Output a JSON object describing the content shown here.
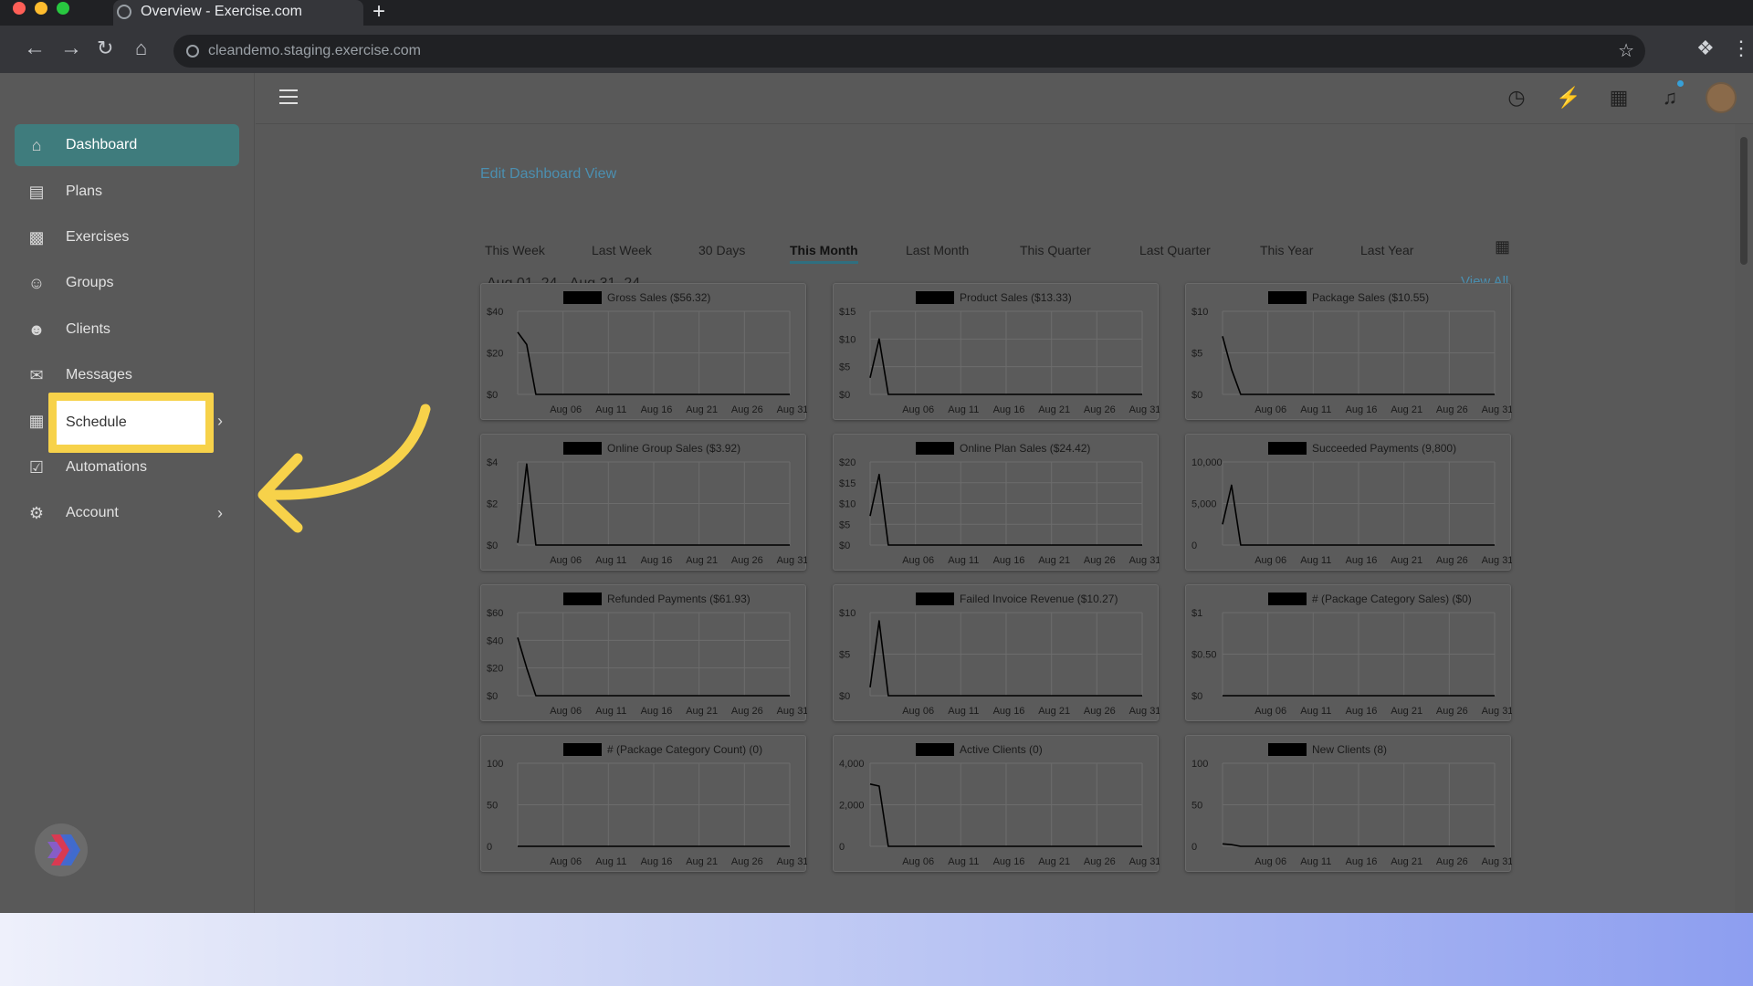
{
  "browser": {
    "tab_title": "Overview - Exercise.com",
    "new_tab": "+",
    "url": "cleandemo.staging.exercise.com"
  },
  "sidebar": {
    "items": [
      {
        "label": "Dashboard",
        "icon": "home-icon"
      },
      {
        "label": "Plans",
        "icon": "clipboard-icon"
      },
      {
        "label": "Exercises",
        "icon": "dumbbell-icon"
      },
      {
        "label": "Groups",
        "icon": "users-icon"
      },
      {
        "label": "Clients",
        "icon": "user-icon"
      },
      {
        "label": "Messages",
        "icon": "envelope-icon"
      },
      {
        "label": "Schedule",
        "icon": "calendar-icon"
      },
      {
        "label": "Automations",
        "icon": "checkbox-icon"
      },
      {
        "label": "Account",
        "icon": "gear-icon"
      }
    ]
  },
  "dashboard": {
    "edit_link": "Edit Dashboard View",
    "filters": [
      "This Week",
      "Last Week",
      "30 Days",
      "This Month",
      "Last Month",
      "This Quarter",
      "Last Quarter",
      "This Year",
      "Last Year"
    ],
    "active_filter": "This Month",
    "date_range": "Aug 01, 24 - Aug 31, 24",
    "view_all": "View All"
  },
  "colors": {
    "accent": "#3f7c7d",
    "link": "#4b8fb0",
    "highlight": "#f7d24a",
    "arrow": "#f7d24a"
  },
  "chart_data": [
    {
      "type": "line",
      "title": "Gross Sales ($56.32)",
      "x": [
        "Aug 01",
        "Aug 02",
        "Aug 03",
        "Aug 04",
        "Aug 05",
        "Aug 06",
        "Aug 11",
        "Aug 16",
        "Aug 21",
        "Aug 26",
        "Aug 31"
      ],
      "xticks": [
        "Aug 06",
        "Aug 11",
        "Aug 16",
        "Aug 21",
        "Aug 26",
        "Aug 31"
      ],
      "yticks": [
        "$0",
        "$20",
        "$40"
      ],
      "ylim": [
        0,
        40
      ],
      "values": [
        30,
        24,
        0,
        0,
        0,
        0,
        0,
        0,
        0,
        0,
        0
      ]
    },
    {
      "type": "line",
      "title": "Product Sales ($13.33)",
      "x": [
        "Aug 01",
        "Aug 02",
        "Aug 03",
        "Aug 04",
        "Aug 05",
        "Aug 06",
        "Aug 11",
        "Aug 16",
        "Aug 21",
        "Aug 26",
        "Aug 31"
      ],
      "xticks": [
        "Aug 06",
        "Aug 11",
        "Aug 16",
        "Aug 21",
        "Aug 26",
        "Aug 31"
      ],
      "yticks": [
        "$0",
        "$5",
        "$10",
        "$15"
      ],
      "ylim": [
        0,
        15
      ],
      "values": [
        3,
        10,
        0,
        0,
        0,
        0,
        0,
        0,
        0,
        0,
        0
      ]
    },
    {
      "type": "line",
      "title": "Package Sales ($10.55)",
      "x": [
        "Aug 01",
        "Aug 02",
        "Aug 03",
        "Aug 04",
        "Aug 05",
        "Aug 06",
        "Aug 11",
        "Aug 16",
        "Aug 21",
        "Aug 26",
        "Aug 31"
      ],
      "xticks": [
        "Aug 06",
        "Aug 11",
        "Aug 16",
        "Aug 21",
        "Aug 26",
        "Aug 31"
      ],
      "yticks": [
        "$0",
        "$5",
        "$10"
      ],
      "ylim": [
        0,
        10
      ],
      "values": [
        7,
        3,
        0,
        0,
        0,
        0,
        0,
        0,
        0,
        0,
        0
      ]
    },
    {
      "type": "line",
      "title": "Online Group Sales ($3.92)",
      "x": [
        "Aug 01",
        "Aug 02",
        "Aug 03",
        "Aug 04",
        "Aug 05",
        "Aug 06",
        "Aug 11",
        "Aug 16",
        "Aug 21",
        "Aug 26",
        "Aug 31"
      ],
      "xticks": [
        "Aug 06",
        "Aug 11",
        "Aug 16",
        "Aug 21",
        "Aug 26",
        "Aug 31"
      ],
      "yticks": [
        "$0",
        "$2",
        "$4"
      ],
      "ylim": [
        0,
        4
      ],
      "values": [
        0.1,
        3.9,
        0,
        0,
        0,
        0,
        0,
        0,
        0,
        0,
        0
      ]
    },
    {
      "type": "line",
      "title": "Online Plan Sales ($24.42)",
      "x": [
        "Aug 01",
        "Aug 02",
        "Aug 03",
        "Aug 04",
        "Aug 05",
        "Aug 06",
        "Aug 11",
        "Aug 16",
        "Aug 21",
        "Aug 26",
        "Aug 31"
      ],
      "xticks": [
        "Aug 06",
        "Aug 11",
        "Aug 16",
        "Aug 21",
        "Aug 26",
        "Aug 31"
      ],
      "yticks": [
        "$0",
        "$5",
        "$10",
        "$15",
        "$20"
      ],
      "ylim": [
        0,
        20
      ],
      "values": [
        7,
        17,
        0,
        0,
        0,
        0,
        0,
        0,
        0,
        0,
        0
      ]
    },
    {
      "type": "line",
      "title": "Succeeded Payments (9,800)",
      "x": [
        "Aug 01",
        "Aug 02",
        "Aug 03",
        "Aug 04",
        "Aug 05",
        "Aug 06",
        "Aug 11",
        "Aug 16",
        "Aug 21",
        "Aug 26",
        "Aug 31"
      ],
      "xticks": [
        "Aug 06",
        "Aug 11",
        "Aug 16",
        "Aug 21",
        "Aug 26",
        "Aug 31"
      ],
      "yticks": [
        "0",
        "5,000",
        "10,000"
      ],
      "ylim": [
        0,
        10000
      ],
      "values": [
        2500,
        7200,
        0,
        0,
        0,
        0,
        0,
        0,
        0,
        0,
        0
      ]
    },
    {
      "type": "line",
      "title": "Refunded Payments ($61.93)",
      "x": [
        "Aug 01",
        "Aug 02",
        "Aug 03",
        "Aug 04",
        "Aug 05",
        "Aug 06",
        "Aug 11",
        "Aug 16",
        "Aug 21",
        "Aug 26",
        "Aug 31"
      ],
      "xticks": [
        "Aug 06",
        "Aug 11",
        "Aug 16",
        "Aug 21",
        "Aug 26",
        "Aug 31"
      ],
      "yticks": [
        "$0",
        "$20",
        "$40",
        "$60"
      ],
      "ylim": [
        0,
        60
      ],
      "values": [
        42,
        20,
        0,
        0,
        0,
        0,
        0,
        0,
        0,
        0,
        0
      ]
    },
    {
      "type": "line",
      "title": "Failed Invoice Revenue ($10.27)",
      "x": [
        "Aug 01",
        "Aug 02",
        "Aug 03",
        "Aug 04",
        "Aug 05",
        "Aug 06",
        "Aug 11",
        "Aug 16",
        "Aug 21",
        "Aug 26",
        "Aug 31"
      ],
      "xticks": [
        "Aug 06",
        "Aug 11",
        "Aug 16",
        "Aug 21",
        "Aug 26",
        "Aug 31"
      ],
      "yticks": [
        "$0",
        "$5",
        "$10"
      ],
      "ylim": [
        0,
        10
      ],
      "values": [
        1,
        9,
        0,
        0,
        0,
        0,
        0,
        0,
        0,
        0,
        0
      ]
    },
    {
      "type": "line",
      "title": "# (Package Category Sales) ($0)",
      "x": [
        "Aug 01",
        "Aug 02",
        "Aug 03",
        "Aug 04",
        "Aug 05",
        "Aug 06",
        "Aug 11",
        "Aug 16",
        "Aug 21",
        "Aug 26",
        "Aug 31"
      ],
      "xticks": [
        "Aug 06",
        "Aug 11",
        "Aug 16",
        "Aug 21",
        "Aug 26",
        "Aug 31"
      ],
      "yticks": [
        "$0",
        "$0.50",
        "$1"
      ],
      "ylim": [
        0,
        1
      ],
      "values": [
        0,
        0,
        0,
        0,
        0,
        0,
        0,
        0,
        0,
        0,
        0
      ]
    },
    {
      "type": "line",
      "title": "# (Package Category Count) (0)",
      "x": [
        "Aug 01",
        "Aug 02",
        "Aug 03",
        "Aug 04",
        "Aug 05",
        "Aug 06",
        "Aug 11",
        "Aug 16",
        "Aug 21",
        "Aug 26",
        "Aug 31"
      ],
      "xticks": [
        "Aug 06",
        "Aug 11",
        "Aug 16",
        "Aug 21",
        "Aug 26",
        "Aug 31"
      ],
      "yticks": [
        "0",
        "50",
        "100"
      ],
      "ylim": [
        0,
        100
      ],
      "values": [
        0,
        0,
        0,
        0,
        0,
        0,
        0,
        0,
        0,
        0,
        0
      ]
    },
    {
      "type": "line",
      "title": "Active Clients (0)",
      "x": [
        "Aug 01",
        "Aug 02",
        "Aug 03",
        "Aug 04",
        "Aug 05",
        "Aug 06",
        "Aug 11",
        "Aug 16",
        "Aug 21",
        "Aug 26",
        "Aug 31"
      ],
      "xticks": [
        "Aug 06",
        "Aug 11",
        "Aug 16",
        "Aug 21",
        "Aug 26",
        "Aug 31"
      ],
      "yticks": [
        "0",
        "2,000",
        "4,000"
      ],
      "ylim": [
        0,
        4000
      ],
      "values": [
        3000,
        2900,
        0,
        0,
        0,
        0,
        0,
        0,
        0,
        0,
        0
      ]
    },
    {
      "type": "line",
      "title": "New Clients (8)",
      "x": [
        "Aug 01",
        "Aug 02",
        "Aug 03",
        "Aug 04",
        "Aug 05",
        "Aug 06",
        "Aug 11",
        "Aug 16",
        "Aug 21",
        "Aug 26",
        "Aug 31"
      ],
      "xticks": [
        "Aug 06",
        "Aug 11",
        "Aug 16",
        "Aug 21",
        "Aug 26",
        "Aug 31"
      ],
      "yticks": [
        "0",
        "50",
        "100"
      ],
      "ylim": [
        0,
        100
      ],
      "values": [
        3,
        2,
        0,
        0,
        0,
        0,
        0,
        0,
        0,
        0,
        0
      ]
    }
  ]
}
